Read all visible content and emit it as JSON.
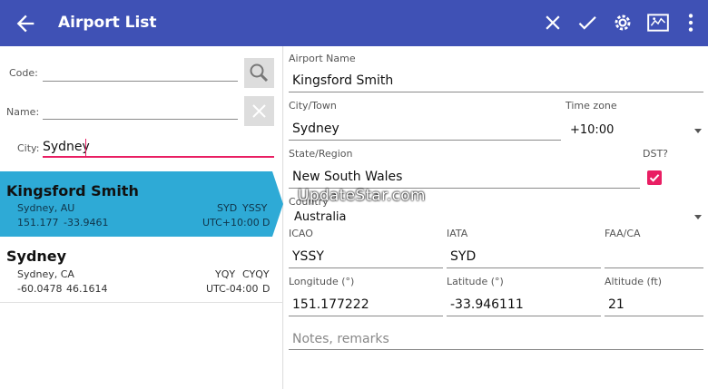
{
  "appbar": {
    "title": "Airport List",
    "back_icon": "arrow-left-icon",
    "actions": [
      "close-icon",
      "check-icon",
      "gear-icon",
      "map-icon",
      "more-vert-icon"
    ],
    "color": "#3f51b5"
  },
  "search": {
    "code_label": "Code:",
    "code_value": "",
    "name_label": "Name:",
    "name_value": "",
    "city_label": "City:",
    "city_value": "Sydney"
  },
  "list": {
    "items": [
      {
        "name": "Kingsford Smith",
        "location": "Sydney, AU",
        "iata": "SYD",
        "icao": "YSSY",
        "lon": "151.177",
        "lat": "-33.9461",
        "tz": "UTC+10:00",
        "dst": "D",
        "selected": true
      },
      {
        "name": "Sydney",
        "location": "Sydney, CA",
        "iata": "YQY",
        "icao": "CYQY",
        "lon": "-60.0478",
        "lat": "46.1614",
        "tz": "UTC-04:00",
        "dst": "D",
        "selected": false
      }
    ]
  },
  "details": {
    "airport_name_label": "Airport Name",
    "airport_name": "Kingsford Smith",
    "city_label": "City/Town",
    "city": "Sydney",
    "timezone_label": "Time zone",
    "timezone": "+10:00",
    "state_label": "State/Region",
    "state": "New South Wales",
    "dst_label": "DST?",
    "dst_checked": true,
    "country_label": "Country",
    "country": "Australia",
    "icao_label": "ICAO",
    "icao": "YSSY",
    "iata_label": "IATA",
    "iata": "SYD",
    "faa_label": "FAA/CA",
    "faa": "",
    "lon_label": "Longitude (°)",
    "lon": "151.177222",
    "lat_label": "Latitude (°)",
    "lat": "-33.946111",
    "alt_label": "Altitude (ft)",
    "alt": "21",
    "notes_placeholder": "Notes, remarks"
  },
  "watermark": "UpdateStar.com",
  "colors": {
    "accent": "#e91e63",
    "selection": "#2eaad6"
  }
}
